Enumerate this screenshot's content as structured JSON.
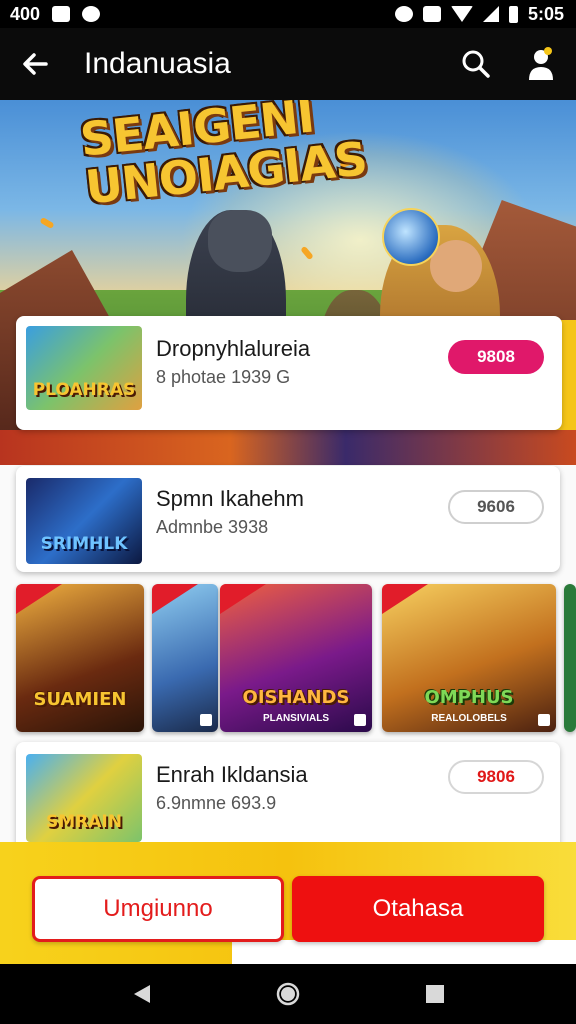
{
  "status_bar": {
    "left_text": "400",
    "time": "5:05",
    "icons": [
      "gallery-icon",
      "chat-icon",
      "alarm-icon",
      "nfc-icon",
      "wifi-icon",
      "signal-icon",
      "battery-icon"
    ]
  },
  "app_bar": {
    "title": "Indanuasia",
    "icons": [
      "back-arrow-icon",
      "search-icon",
      "profile-icon"
    ]
  },
  "hero": {
    "title_line1": "SEAIGENI",
    "title_line2": "UNOIAGIAS"
  },
  "cards": [
    {
      "title": "Dropnyhlalureia",
      "subtitle": "8 photae 1939 G",
      "badge": "9808",
      "thumb_label": "PLOAHRAS",
      "badge_style": "solid"
    },
    {
      "title": "Spmn Ikahehm",
      "subtitle": "Admnbe 3938",
      "badge": "9606",
      "thumb_label": "SRIMHLK",
      "badge_style": "outline-gray"
    },
    {
      "title": "Enrah Ikldansia",
      "subtitle": "6.9nmne 693.9",
      "badge": "9806",
      "thumb_label": "SMRAIN",
      "badge_style": "outline-red"
    }
  ],
  "game_strip": [
    {
      "label": "SUAMIEN",
      "sublabel": ""
    },
    {
      "label": "",
      "sublabel": ""
    },
    {
      "label": "OISHANDS",
      "sublabel": "PLANSIVIALS"
    },
    {
      "label": "OMPHUS",
      "sublabel": "REALOLOBELS"
    }
  ],
  "actions": {
    "secondary": "Umgiunno",
    "primary": "Otahasa"
  },
  "colors": {
    "accent_pink": "#e0186a",
    "accent_red": "#ee1010",
    "accent_yellow": "#f5c518",
    "app_bar": "#0b0b0b"
  }
}
